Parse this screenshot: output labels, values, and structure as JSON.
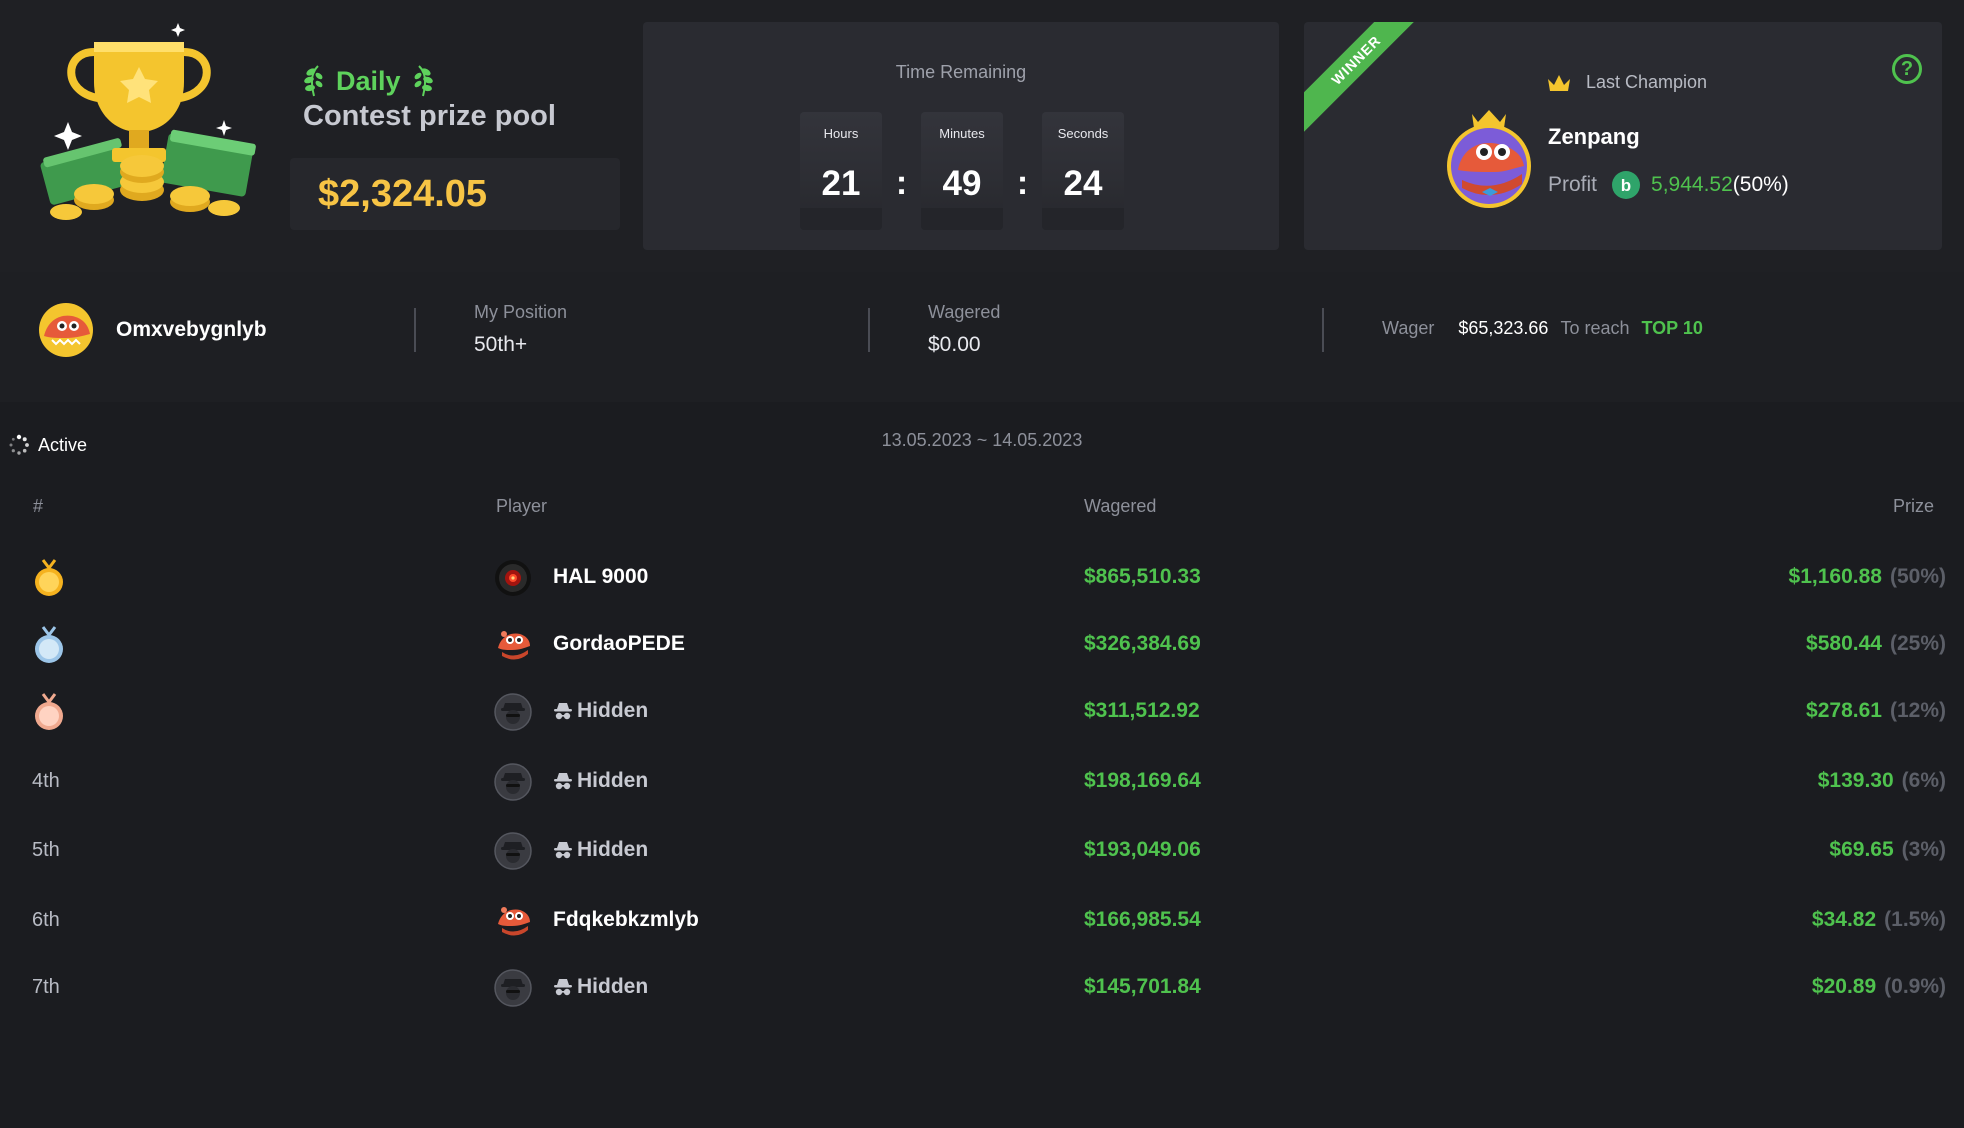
{
  "contest": {
    "period_label": "Daily",
    "title": "Contest prize pool",
    "pool_amount": "$2,324.05"
  },
  "timer": {
    "title": "Time Remaining",
    "hours_label": "Hours",
    "hours": "21",
    "minutes_label": "Minutes",
    "minutes": "49",
    "seconds_label": "Seconds",
    "seconds": "24",
    "separator": ":"
  },
  "champion": {
    "ribbon": "WINNER",
    "header": "Last Champion",
    "name": "Zenpang",
    "profit_label": "Profit",
    "profit_value": "5,944.52",
    "profit_pct": "(50%)",
    "help": "?"
  },
  "me": {
    "username": "Omxvebygnlyb",
    "position_label": "My Position",
    "position_value": "50th+",
    "wagered_label": "Wagered",
    "wagered_value": "$0.00",
    "wager_label": "Wager",
    "wager_amount": "$65,323.66",
    "reach_label": "To reach",
    "reach_target": "TOP 10"
  },
  "board": {
    "status": "Active",
    "date_range": "13.05.2023 ~ 14.05.2023",
    "columns": {
      "rank": "#",
      "player": "Player",
      "wagered": "Wagered",
      "prize": "Prize"
    },
    "rows": [
      {
        "rank": "",
        "medal": "gold-medal",
        "avatar": "hal-avatar",
        "name": "HAL 9000",
        "hidden": false,
        "wagered": "$865,510.33",
        "prize": "$1,160.88",
        "pct": "(50%)"
      },
      {
        "rank": "",
        "medal": "silver-medal",
        "avatar": "croc-avatar",
        "name": "GordaoPEDE",
        "hidden": false,
        "wagered": "$326,384.69",
        "prize": "$580.44",
        "pct": "(25%)"
      },
      {
        "rank": "",
        "medal": "bronze-medal",
        "avatar": "spy-avatar",
        "name": "Hidden",
        "hidden": true,
        "wagered": "$311,512.92",
        "prize": "$278.61",
        "pct": "(12%)"
      },
      {
        "rank": "4th",
        "medal": "",
        "avatar": "spy-avatar",
        "name": "Hidden",
        "hidden": true,
        "wagered": "$198,169.64",
        "prize": "$139.30",
        "pct": "(6%)"
      },
      {
        "rank": "5th",
        "medal": "",
        "avatar": "spy-avatar",
        "name": "Hidden",
        "hidden": true,
        "wagered": "$193,049.06",
        "prize": "$69.65",
        "pct": "(3%)"
      },
      {
        "rank": "6th",
        "medal": "",
        "avatar": "croc-avatar",
        "name": "Fdqkebkzmlyb",
        "hidden": false,
        "wagered": "$166,985.54",
        "prize": "$34.82",
        "pct": "(1.5%)"
      },
      {
        "rank": "7th",
        "medal": "",
        "avatar": "spy-avatar",
        "name": "Hidden",
        "hidden": true,
        "wagered": "$145,701.84",
        "prize": "$20.89",
        "pct": "(0.9%)"
      }
    ]
  },
  "colors": {
    "accent_green": "#4fc24e",
    "gold": "#f7c445",
    "background": "#1b1c20",
    "card": "#2a2b31"
  }
}
